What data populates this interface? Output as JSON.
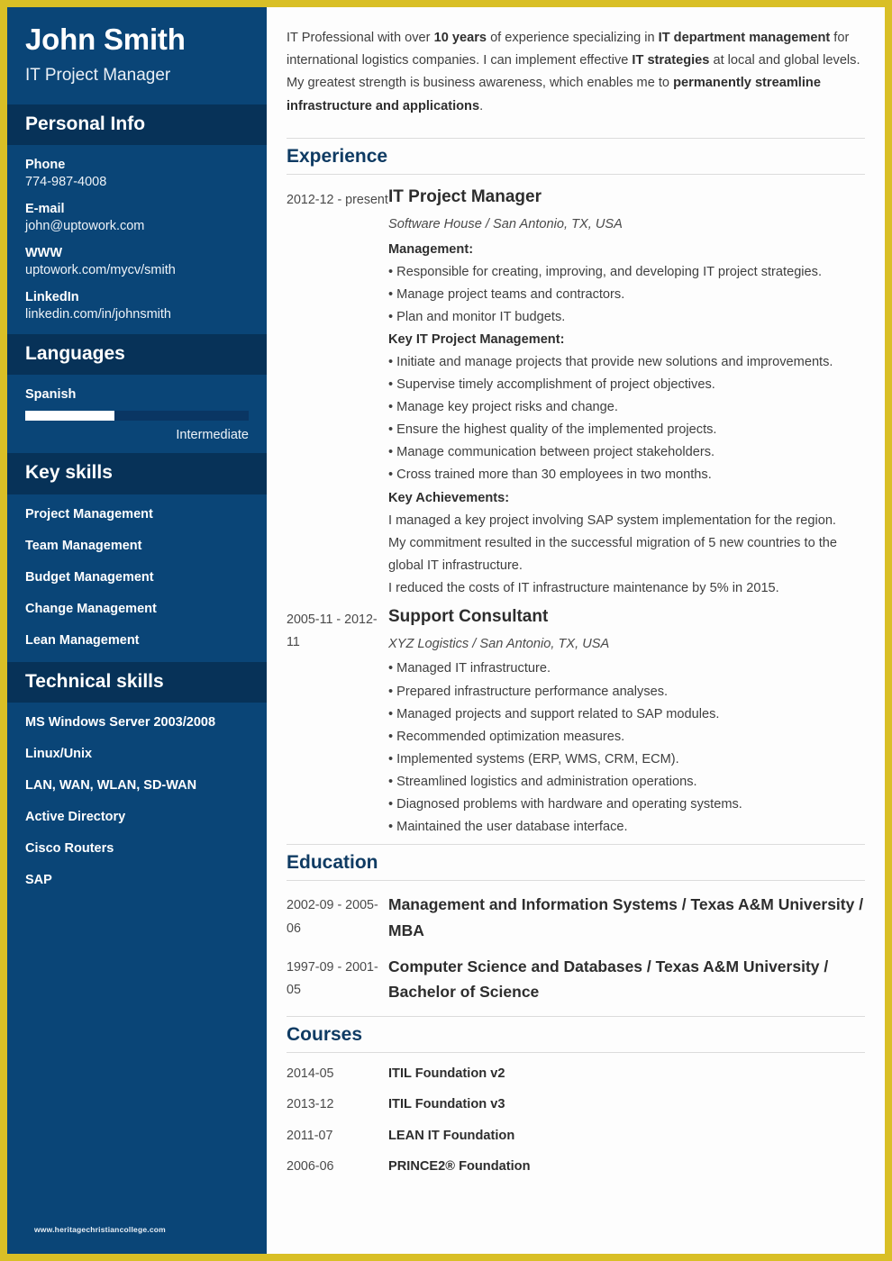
{
  "theme": {
    "border_color": "#d9bf26",
    "sidebar_bg": "#0a4577",
    "sidebar_band_bg": "#073258",
    "section_title_color": "#0f3b63"
  },
  "sidebar": {
    "full_name": "John Smith",
    "job_title": "IT Project Manager",
    "personal_info": {
      "heading": "Personal Info",
      "items": [
        {
          "label": "Phone",
          "value": "774-987-4008"
        },
        {
          "label": "E-mail",
          "value": "john@uptowork.com"
        },
        {
          "label": "WWW",
          "value": "uptowork.com/mycv/smith"
        },
        {
          "label": "LinkedIn",
          "value": "linkedin.com/in/johnsmith"
        }
      ]
    },
    "languages": {
      "heading": "Languages",
      "items": [
        {
          "name": "Spanish",
          "level": "Intermediate",
          "percent": 40
        }
      ]
    },
    "key_skills": {
      "heading": "Key skills",
      "items": [
        "Project Management",
        "Team Management",
        "Budget Management",
        "Change Management",
        "Lean Management"
      ]
    },
    "technical_skills": {
      "heading": "Technical skills",
      "items": [
        "MS Windows Server 2003/2008",
        "Linux/Unix",
        "LAN, WAN, WLAN, SD-WAN",
        "Active Directory",
        "Cisco Routers",
        "SAP"
      ]
    },
    "watermark": "www.heritagechristiancollege.com"
  },
  "main": {
    "summary": {
      "parts": [
        {
          "text": "IT Professional with over ",
          "bold": false
        },
        {
          "text": "10 years",
          "bold": true
        },
        {
          "text": " of experience specializing in ",
          "bold": false
        },
        {
          "text": "IT department management",
          "bold": true
        },
        {
          "text": " for international logistics companies. I can implement effective ",
          "bold": false
        },
        {
          "text": "IT strategies",
          "bold": true
        },
        {
          "text": " at local and global levels. My greatest strength is business awareness, which enables me to ",
          "bold": false
        },
        {
          "text": "permanently streamline infrastructure and applications",
          "bold": true
        },
        {
          "text": ".",
          "bold": false
        }
      ]
    },
    "experience": {
      "heading": "Experience",
      "entries": [
        {
          "date": "2012-12 - present",
          "role": "IT Project Manager",
          "company": "Software House / San Antonio, TX, USA",
          "blocks": [
            {
              "type": "subhead",
              "text": "Management:"
            },
            {
              "type": "bullet",
              "text": "Responsible for creating, improving, and developing IT project strategies."
            },
            {
              "type": "bullet",
              "text": "Manage project teams and contractors."
            },
            {
              "type": "bullet",
              "text": "Plan and monitor IT budgets."
            },
            {
              "type": "subhead",
              "text": "Key IT Project Management:"
            },
            {
              "type": "bullet",
              "text": "Initiate and manage projects that provide new solutions and improvements."
            },
            {
              "type": "bullet",
              "text": "Supervise timely accomplishment of project objectives."
            },
            {
              "type": "bullet",
              "text": "Manage key project risks and change."
            },
            {
              "type": "bullet",
              "text": "Ensure the highest quality of the implemented projects."
            },
            {
              "type": "bullet",
              "text": "Manage communication between project stakeholders."
            },
            {
              "type": "bullet",
              "text": "Cross trained more than 30 employees in two months."
            },
            {
              "type": "subhead",
              "text": "Key Achievements:"
            },
            {
              "type": "plain",
              "text": "I managed a key project involving SAP system implementation for the region."
            },
            {
              "type": "plain",
              "text": "My commitment resulted in the successful migration of 5 new countries to the global IT infrastructure."
            },
            {
              "type": "plain",
              "text": "I reduced the costs of IT infrastructure maintenance by 5% in 2015."
            }
          ]
        },
        {
          "date": "2005-11 - 2012-11",
          "role": "Support Consultant",
          "company": "XYZ Logistics / San Antonio, TX, USA",
          "blocks": [
            {
              "type": "bullet",
              "text": "Managed IT infrastructure."
            },
            {
              "type": "bullet",
              "text": "Prepared infrastructure performance analyses."
            },
            {
              "type": "bullet",
              "text": "Managed projects and support related to SAP modules."
            },
            {
              "type": "bullet",
              "text": "Recommended optimization measures."
            },
            {
              "type": "bullet",
              "text": "Implemented systems (ERP, WMS, CRM, ECM)."
            },
            {
              "type": "bullet",
              "text": "Streamlined logistics and administration operations."
            },
            {
              "type": "bullet",
              "text": "Diagnosed problems with hardware and operating systems."
            },
            {
              "type": "bullet",
              "text": "Maintained the user database interface."
            }
          ]
        }
      ]
    },
    "education": {
      "heading": "Education",
      "entries": [
        {
          "date": "2002-09 - 2005-06",
          "text": "Management and Information Systems / Texas A&M University / MBA"
        },
        {
          "date": "1997-09 - 2001-05",
          "text": "Computer Science and Databases / Texas A&M University / Bachelor of Science"
        }
      ]
    },
    "courses": {
      "heading": "Courses",
      "entries": [
        {
          "date": "2014-05",
          "name": "ITIL Foundation v2"
        },
        {
          "date": "2013-12",
          "name": "ITIL Foundation v3"
        },
        {
          "date": "2011-07",
          "name": "LEAN IT Foundation"
        },
        {
          "date": "2006-06",
          "name": "PRINCE2® Foundation"
        }
      ]
    }
  }
}
